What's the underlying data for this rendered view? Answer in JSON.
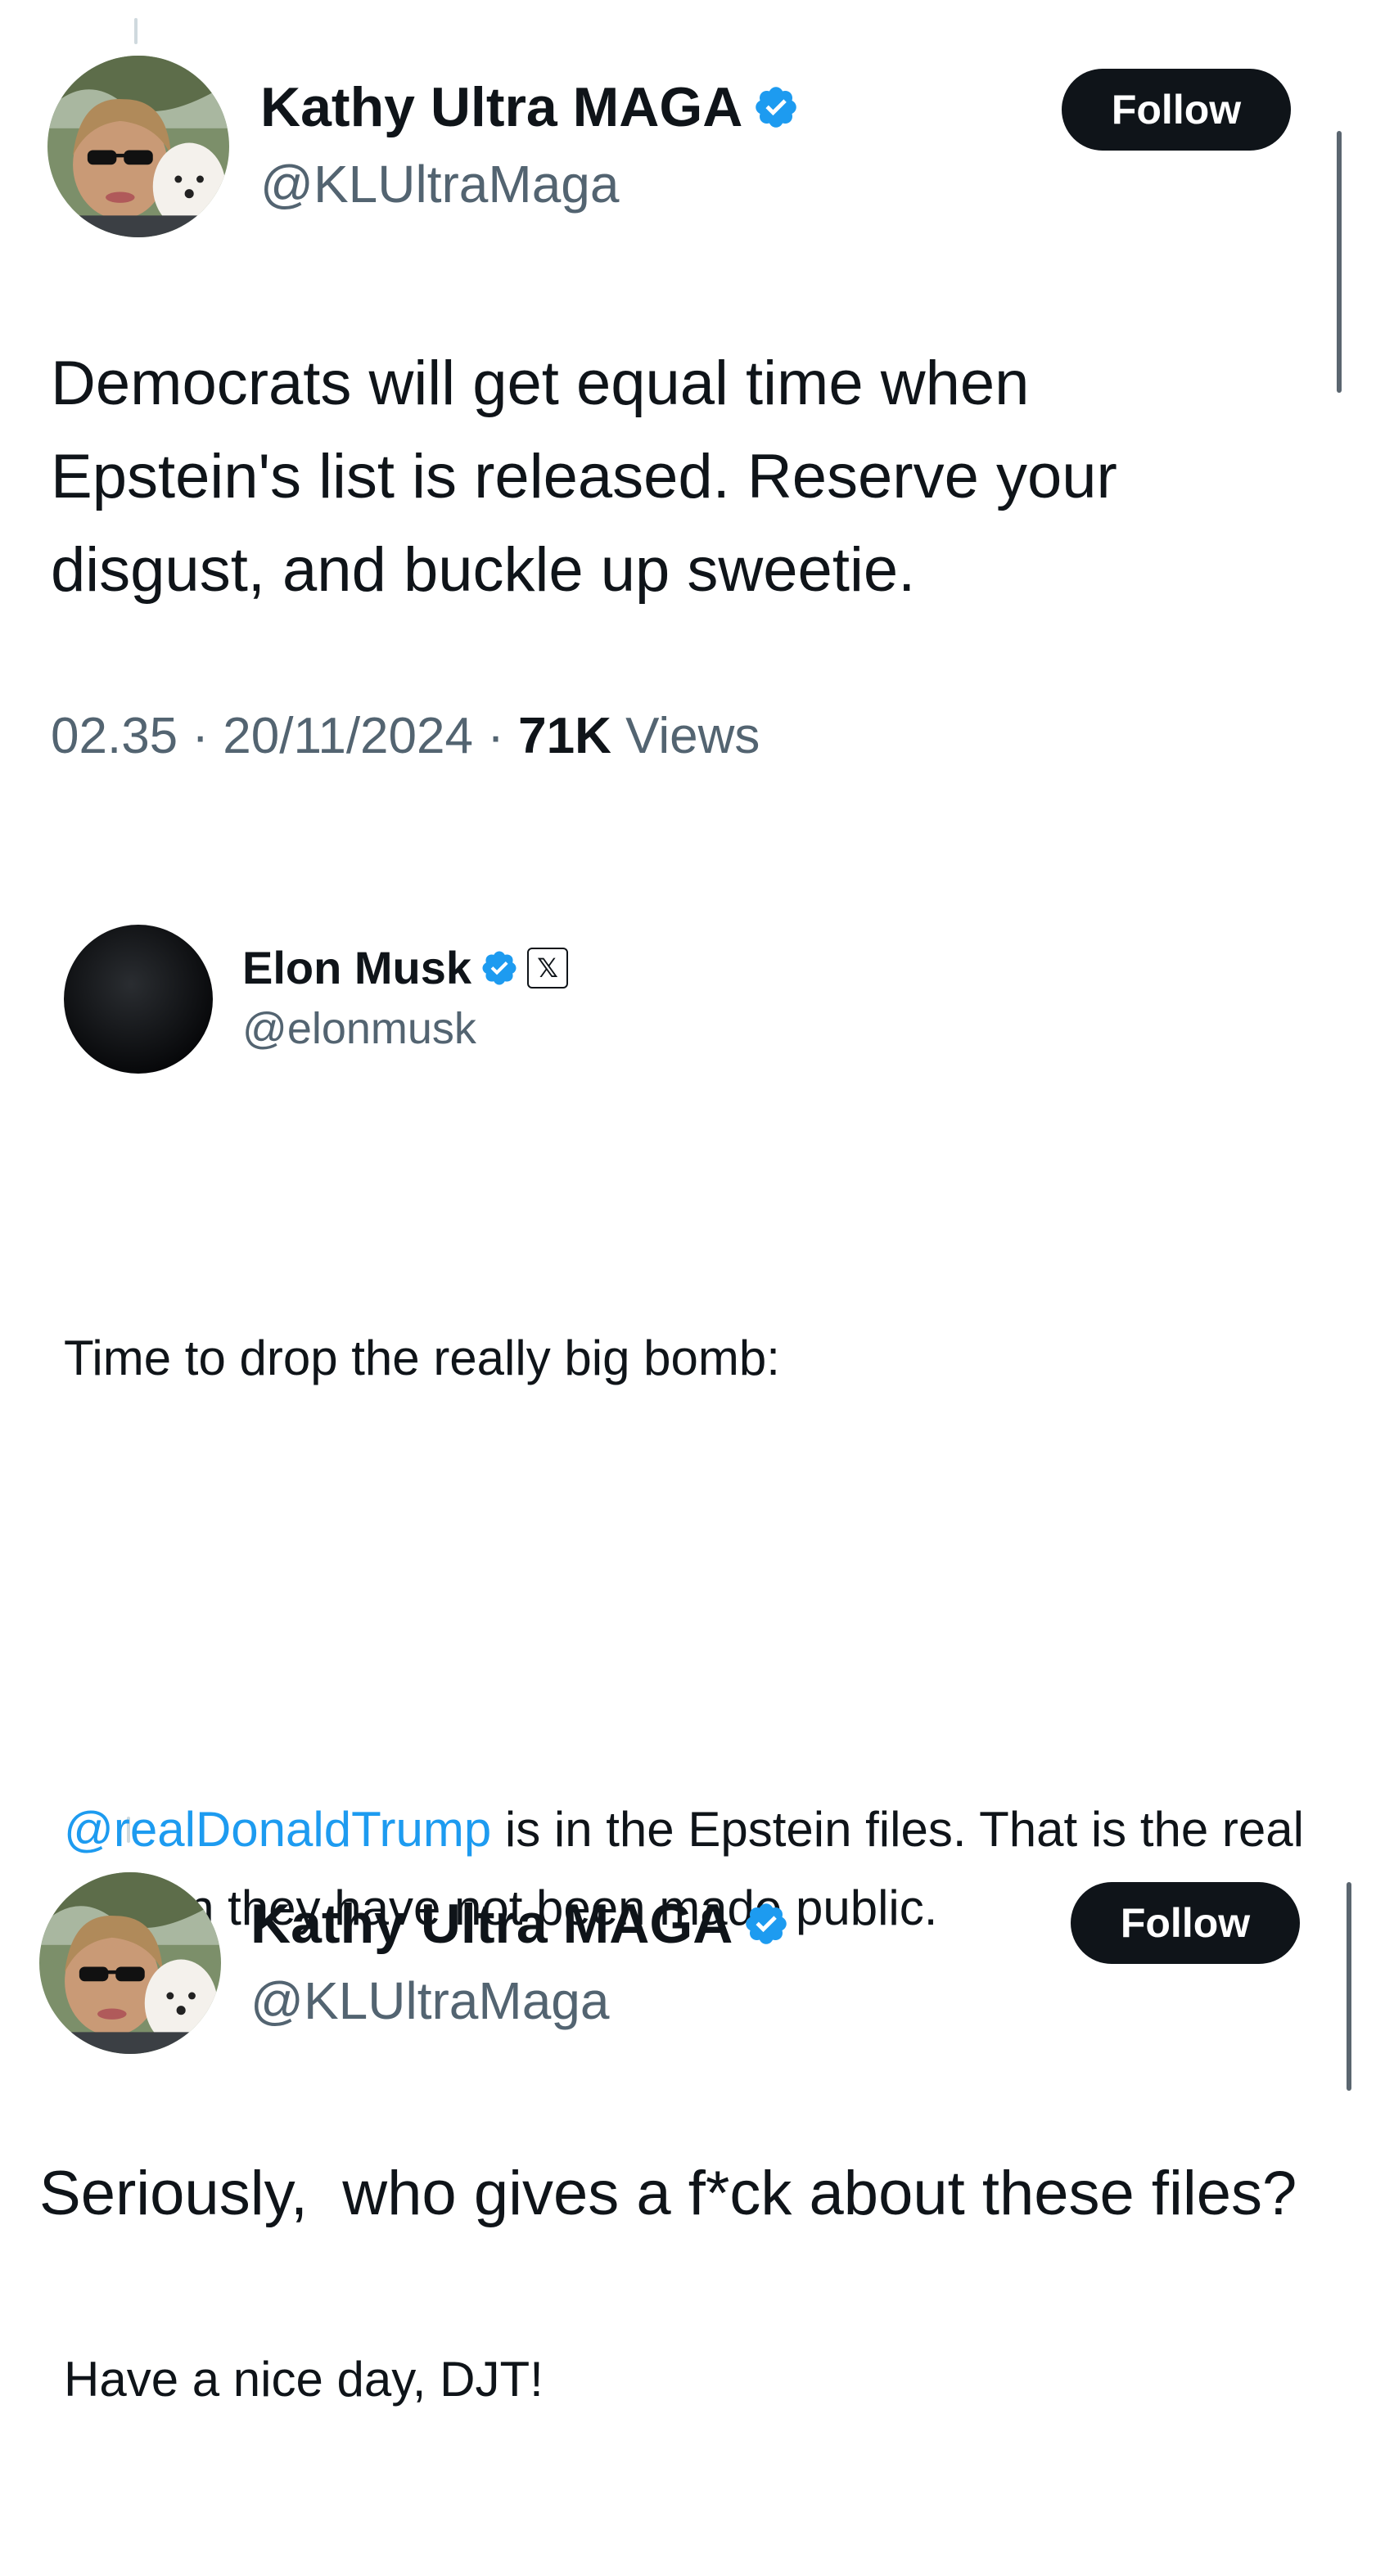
{
  "tweet1": {
    "display_name": "Kathy Ultra MAGA",
    "handle": "@KLUltraMaga",
    "follow_label": "Follow",
    "text": "Democrats will get equal time when Epstein's list is released. Reserve your disgust, and buckle up sweetie.",
    "time": "02.35",
    "date": "20/11/2024",
    "views_count": "71K",
    "views_label": "Views",
    "separator": "·",
    "icons": {
      "verified": "verified-badge-icon",
      "avatar": "avatar-photo"
    }
  },
  "embedded": {
    "display_name": "Elon Musk",
    "handle": "@elonmusk",
    "affiliate_badge": "𝕏",
    "line1": "Time to drop the really big bomb:",
    "mention": "@realDonaldTrump",
    "line2_rest": " is in the Epstein files. That is the real reason they have not been made public.",
    "line3": "Have a nice day, DJT!"
  },
  "tweet2": {
    "display_name": "Kathy Ultra MAGA",
    "handle": "@KLUltraMaga",
    "follow_label": "Follow",
    "text": "Seriously,  who gives a f*ck about these files?"
  },
  "colors": {
    "text": "#0f1419",
    "secondary": "#536471",
    "link": "#1d9bf0",
    "verified": "#1d9bf0",
    "button_bg": "#0f1419",
    "button_text": "#ffffff"
  }
}
